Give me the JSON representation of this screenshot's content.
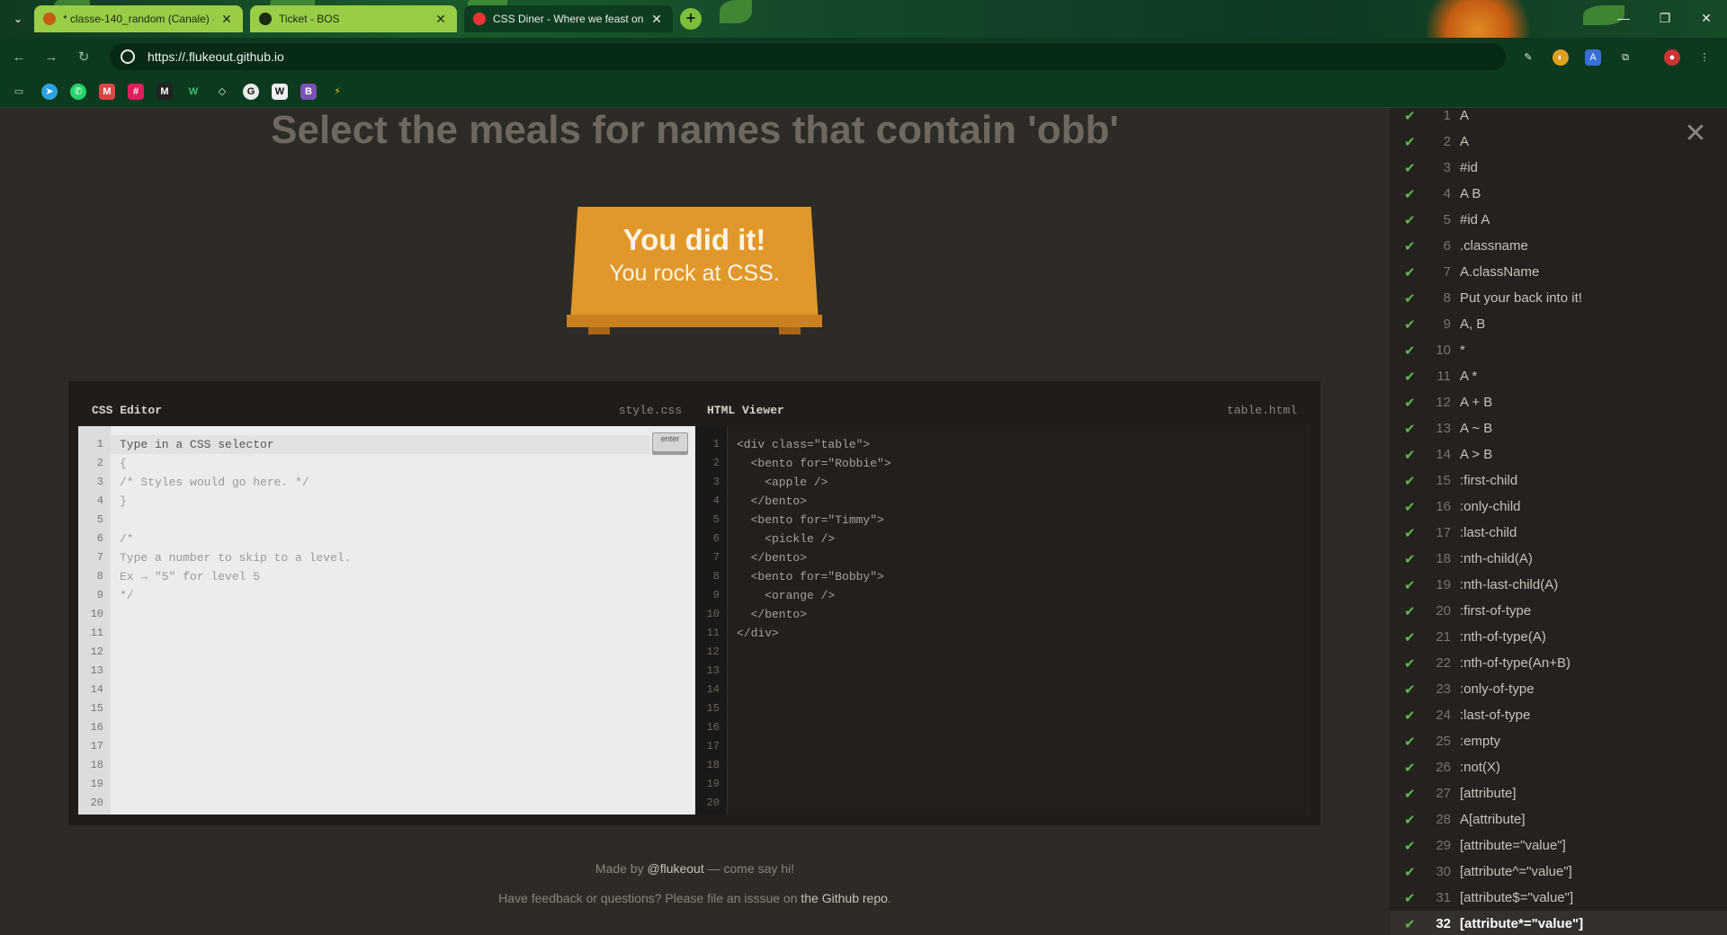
{
  "browser": {
    "tabs": [
      {
        "title": "* classe-140_random (Canale) ·",
        "active": false
      },
      {
        "title": "Ticket - BOS",
        "active": false
      },
      {
        "title": "CSS Diner - Where we feast on",
        "active": true
      }
    ],
    "url": "https://.flukeout.github.io",
    "icons": {
      "tab_menu": "chevron-down-icon",
      "back": "back-arrow-icon",
      "forward": "forward-arrow-icon",
      "reload": "reload-icon",
      "new_tab": "plus-icon"
    },
    "bookmark_icons": [
      "folder-icon",
      "telegram-icon",
      "whatsapp-icon",
      "gmail-icon",
      "slack-icon",
      "m-icon",
      "w-icon",
      "diamond-icon",
      "github-icon",
      "w-square-icon",
      "bootstrap-icon",
      "bolt-icon"
    ]
  },
  "game": {
    "order": "Select the meals for names that contain 'obb'",
    "win_line1": "You did it!",
    "win_line2": "You rock at CSS.",
    "css_editor": {
      "title": "CSS Editor",
      "file": "style.css",
      "placeholder": "Type in a CSS selector",
      "enter_label": "enter",
      "lines": [
        "",
        "{",
        "/* Styles would go here. */",
        "}",
        "",
        "/*",
        "Type a number to skip to a level.",
        "Ex → \"5\" for level 5",
        "*/",
        "",
        "",
        "",
        "",
        "",
        "",
        "",
        "",
        "",
        "",
        ""
      ]
    },
    "html_viewer": {
      "title": "HTML Viewer",
      "file": "table.html",
      "lines": [
        "<div class=\"table\">",
        "  <bento for=\"Robbie\">",
        "    <apple />",
        "  </bento>",
        "  <bento for=\"Timmy\">",
        "    <pickle />",
        "  </bento>",
        "  <bento for=\"Bobby\">",
        "    <orange />",
        "  </bento>",
        "</div>",
        "",
        "",
        "",
        "",
        "",
        "",
        "",
        "",
        ""
      ]
    },
    "footer": {
      "made_by_prefix": "Made by ",
      "made_by_link": "@flukeout",
      "made_by_suffix": " — come say hi!",
      "feedback_prefix": "Have feedback or questions? Please file an isssue on ",
      "feedback_link": "the Github repo",
      "feedback_suffix": "."
    }
  },
  "levels": [
    {
      "num": "1",
      "selector": "A"
    },
    {
      "num": "2",
      "selector": "A"
    },
    {
      "num": "3",
      "selector": "#id"
    },
    {
      "num": "4",
      "selector": "A  B"
    },
    {
      "num": "5",
      "selector": "#id  A"
    },
    {
      "num": "6",
      "selector": ".classname"
    },
    {
      "num": "7",
      "selector": "A.className"
    },
    {
      "num": "8",
      "selector": "Put your back into it!"
    },
    {
      "num": "9",
      "selector": "A, B"
    },
    {
      "num": "10",
      "selector": "*"
    },
    {
      "num": "11",
      "selector": "A  *"
    },
    {
      "num": "12",
      "selector": "A + B"
    },
    {
      "num": "13",
      "selector": "A ~ B"
    },
    {
      "num": "14",
      "selector": "A > B"
    },
    {
      "num": "15",
      "selector": ":first-child"
    },
    {
      "num": "16",
      "selector": ":only-child"
    },
    {
      "num": "17",
      "selector": ":last-child"
    },
    {
      "num": "18",
      "selector": ":nth-child(A)"
    },
    {
      "num": "19",
      "selector": ":nth-last-child(A)"
    },
    {
      "num": "20",
      "selector": ":first-of-type"
    },
    {
      "num": "21",
      "selector": ":nth-of-type(A)"
    },
    {
      "num": "22",
      "selector": ":nth-of-type(An+B)"
    },
    {
      "num": "23",
      "selector": ":only-of-type"
    },
    {
      "num": "24",
      "selector": ":last-of-type"
    },
    {
      "num": "25",
      "selector": ":empty"
    },
    {
      "num": "26",
      "selector": ":not(X)"
    },
    {
      "num": "27",
      "selector": "[attribute]"
    },
    {
      "num": "28",
      "selector": "A[attribute]"
    },
    {
      "num": "29",
      "selector": "[attribute=\"value\"]"
    },
    {
      "num": "30",
      "selector": "[attribute^=\"value\"]"
    },
    {
      "num": "31",
      "selector": "[attribute$=\"value\"]"
    },
    {
      "num": "32",
      "selector": "[attribute*=\"value\"]",
      "current": true
    }
  ],
  "colors": {
    "accent": "#e0972b",
    "check": "#5bb94a",
    "page_bg": "#2e2a26",
    "browser_bg": "#0b3a1f"
  }
}
